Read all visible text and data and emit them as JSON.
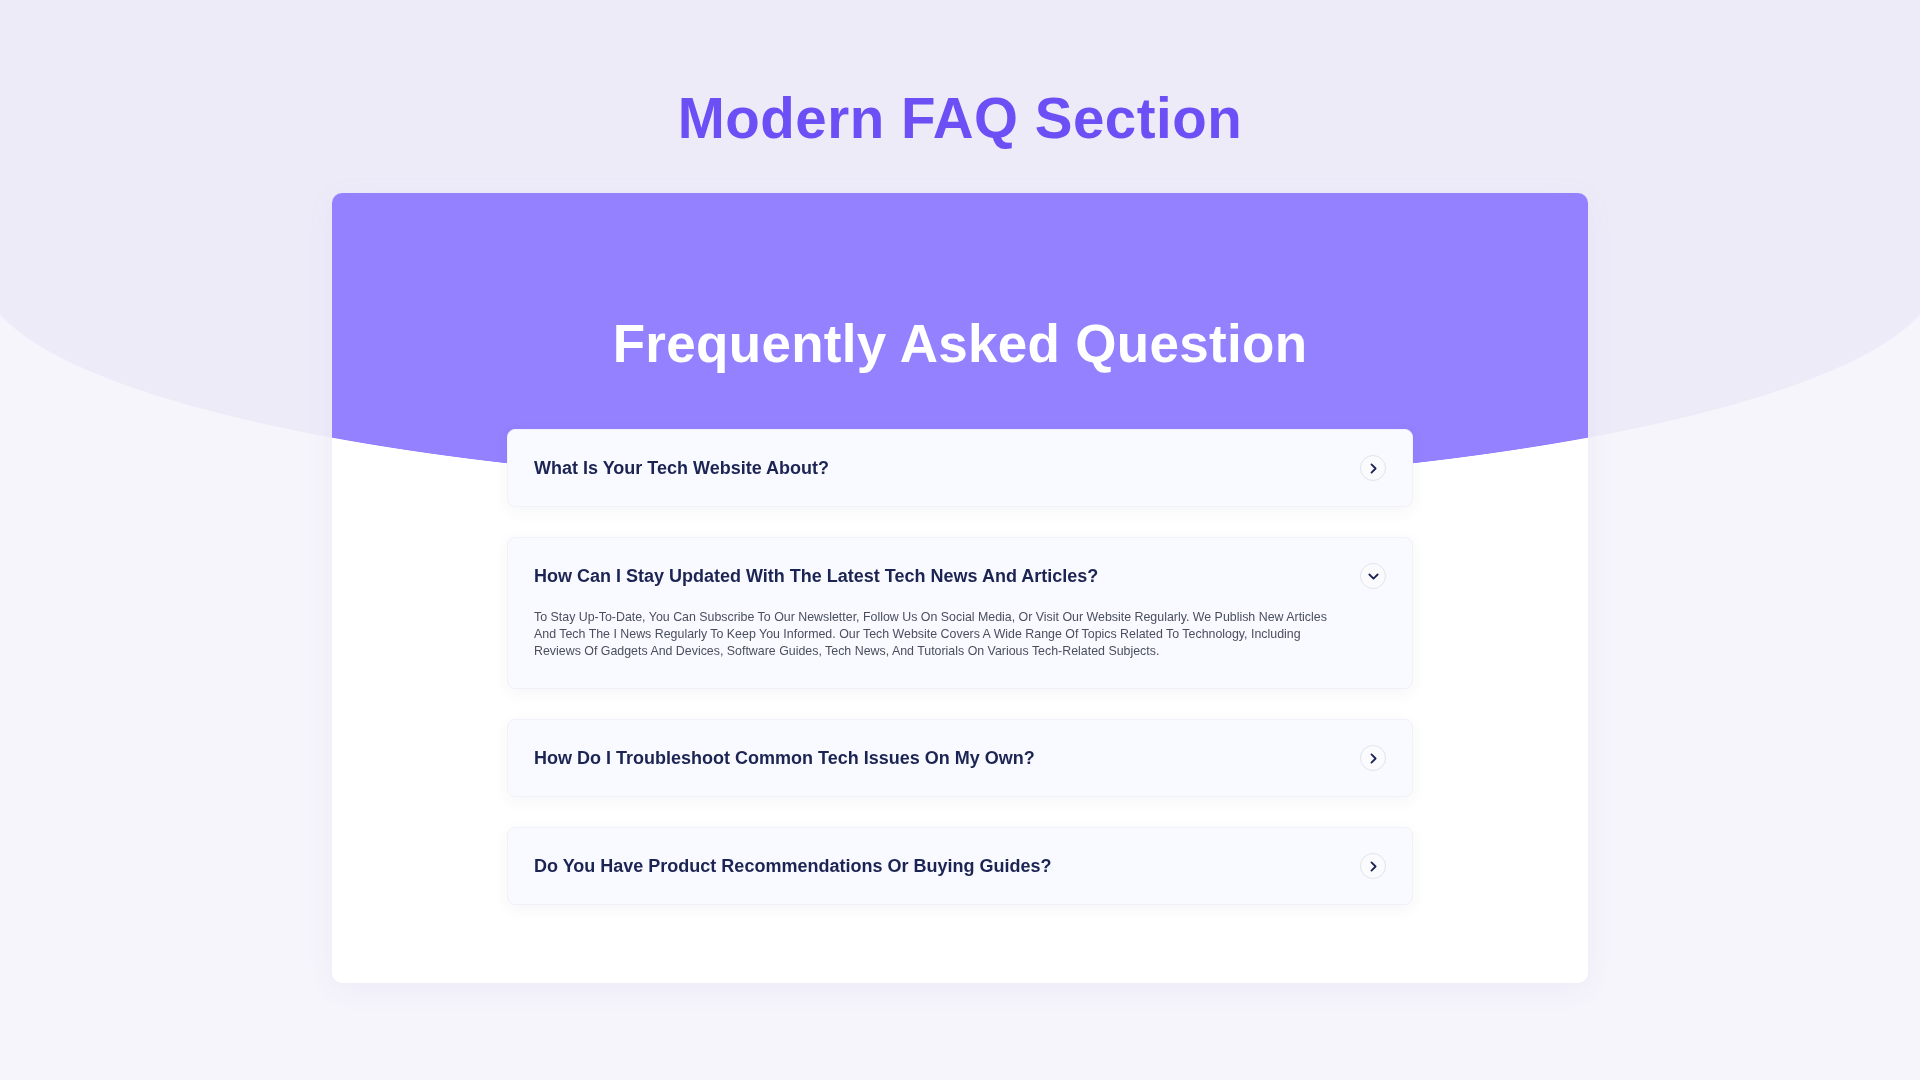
{
  "page_title": "Modern FAQ Section",
  "faq": {
    "heading": "Frequently Asked Question",
    "items": [
      {
        "question": "What Is Your Tech Website About?",
        "expanded": false
      },
      {
        "question": "How Can I Stay Updated With The Latest Tech News And Articles?",
        "expanded": true,
        "answer": "To Stay Up-To-Date, You Can Subscribe To Our Newsletter, Follow Us On Social Media, Or Visit Our Website Regularly. We Publish New Articles And Tech The I News Regularly To Keep You Informed. Our Tech Website Covers A Wide Range Of Topics Related To Technology, Including Reviews Of Gadgets And Devices, Software Guides, Tech News, And Tutorials On Various Tech-Related Subjects."
      },
      {
        "question": "How Do I Troubleshoot Common Tech Issues On My Own?",
        "expanded": false
      },
      {
        "question": "Do You Have Product Recommendations Or Buying Guides?",
        "expanded": false
      }
    ]
  }
}
